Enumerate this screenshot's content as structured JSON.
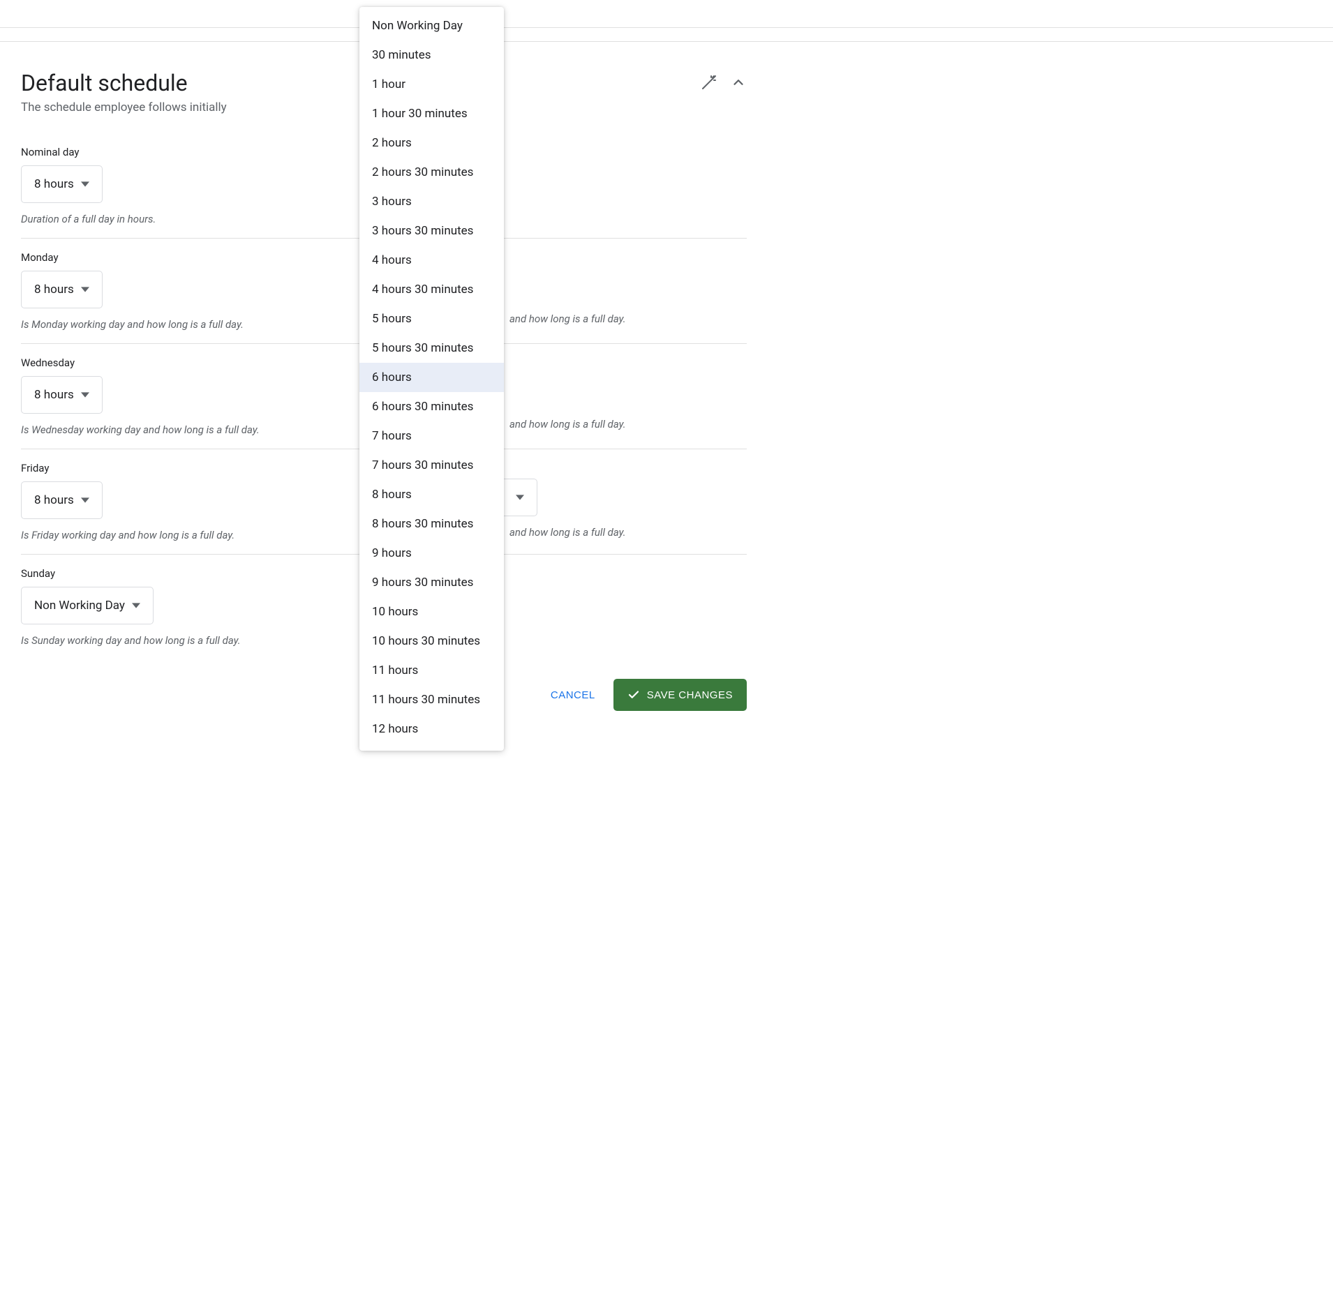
{
  "page": {
    "title": "Default schedule",
    "subtitle": "The schedule employee follows initially"
  },
  "fields": {
    "nominal": {
      "label": "Nominal day",
      "value": "8 hours",
      "helper": "Duration of a full day in hours."
    },
    "monday": {
      "label": "Monday",
      "value": "8 hours",
      "helper": "Is Monday working day and how long is a full day."
    },
    "wednesday": {
      "label": "Wednesday",
      "value": "8 hours",
      "helper": "Is Wednesday working day and how long is a full day."
    },
    "friday": {
      "label": "Friday",
      "value": "8 hours",
      "helper": "Is Friday working day and how long is a full day."
    },
    "sunday": {
      "label": "Sunday",
      "value": "Non Working Day",
      "helper": "Is Sunday working day and how long is a full day."
    },
    "right_helper_peek": "and how long is a full day."
  },
  "actions": {
    "cancel": "CANCEL",
    "save": "SAVE CHANGES"
  },
  "dropdown": {
    "selected_index": 12,
    "options": [
      "Non Working Day",
      "30 minutes",
      "1 hour",
      "1 hour 30 minutes",
      "2 hours",
      "2 hours 30 minutes",
      "3 hours",
      "3 hours 30 minutes",
      "4 hours",
      "4 hours 30 minutes",
      "5 hours",
      "5 hours 30 minutes",
      "6 hours",
      "6 hours 30 minutes",
      "7 hours",
      "7 hours 30 minutes",
      "8 hours",
      "8 hours 30 minutes",
      "9 hours",
      "9 hours 30 minutes",
      "10 hours",
      "10 hours 30 minutes",
      "11 hours",
      "11 hours 30 minutes",
      "12 hours"
    ]
  }
}
